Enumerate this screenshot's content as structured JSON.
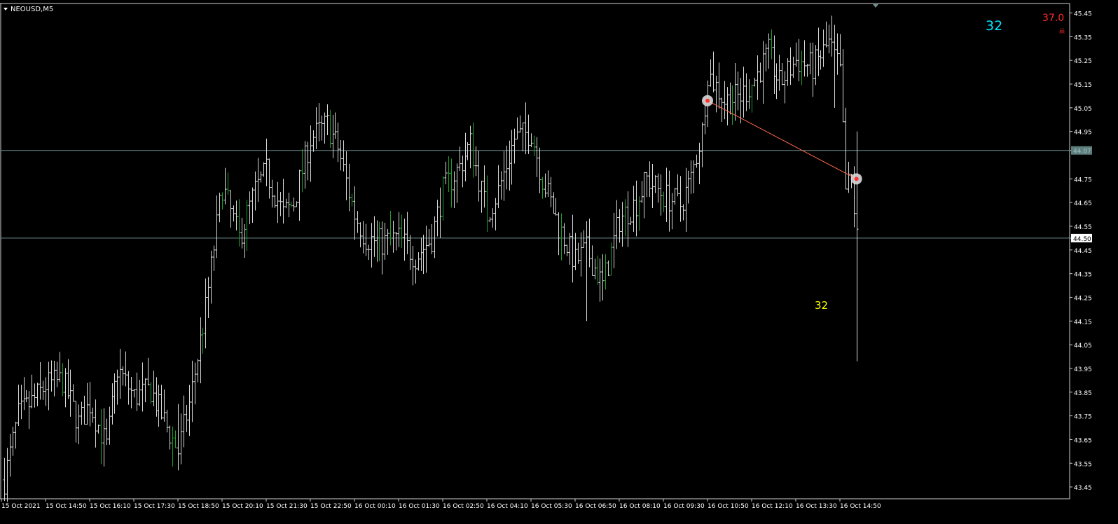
{
  "window": {
    "symbol_title": "NEOUSD,M5"
  },
  "indicators": {
    "counter_cyan": "32",
    "counter_red": "37.0",
    "counter_yellow": "32"
  },
  "colors": {
    "background": "#000000",
    "bar": "#d9d9d9",
    "bar_up": "#1f9e2a",
    "grid_line": "#6f8f8f",
    "trend_line": "#ff6a4a",
    "axis_text": "#ffffff",
    "cyan_text": "#00e5ff",
    "red_text": "#ff2a2a",
    "yellow_text": "#ffff00"
  },
  "chart_data": {
    "type": "ohlc",
    "symbol": "NEOUSD",
    "timeframe": "M5",
    "ylim": [
      43.4,
      45.49
    ],
    "y_ticks": [
      "45.45",
      "45.35",
      "45.25",
      "45.15",
      "45.05",
      "44.95",
      "44.87",
      "44.75",
      "44.65",
      "44.55",
      "44.50",
      "44.45",
      "44.35",
      "44.25",
      "44.15",
      "44.05",
      "43.95",
      "43.85",
      "43.75",
      "43.65",
      "43.55",
      "43.45"
    ],
    "x_ticks": [
      "15 Oct 2021",
      "15 Oct 14:50",
      "15 Oct 16:10",
      "15 Oct 17:30",
      "15 Oct 18:50",
      "15 Oct 20:10",
      "15 Oct 21:30",
      "15 Oct 22:50",
      "16 Oct 00:10",
      "16 Oct 01:30",
      "16 Oct 02:50",
      "16 Oct 04:10",
      "16 Oct 05:30",
      "16 Oct 06:50",
      "16 Oct 08:10",
      "16 Oct 09:30",
      "16 Oct 10:50",
      "16 Oct 12:10",
      "16 Oct 13:30",
      "16 Oct 14:50"
    ],
    "horizontal_lines": [
      {
        "price": 44.87,
        "label": "44.87"
      },
      {
        "price": 44.5,
        "label": "44.50"
      }
    ],
    "trend_line": {
      "from": {
        "time": "16 Oct 10:50",
        "price": 45.08
      },
      "to": {
        "time": "16 Oct 15:20",
        "price": 44.75
      }
    },
    "series_path": [
      {
        "t": "15 Oct 13:35",
        "p": 43.48
      },
      {
        "t": "15 Oct 14:00",
        "p": 43.75
      },
      {
        "t": "15 Oct 14:30",
        "p": 43.82
      },
      {
        "t": "15 Oct 14:50",
        "p": 43.88
      },
      {
        "t": "15 Oct 15:20",
        "p": 43.9
      },
      {
        "t": "15 Oct 15:50",
        "p": 43.72
      },
      {
        "t": "15 Oct 16:10",
        "p": 43.8
      },
      {
        "t": "15 Oct 16:40",
        "p": 43.62
      },
      {
        "t": "15 Oct 17:00",
        "p": 43.95
      },
      {
        "t": "15 Oct 17:30",
        "p": 43.83
      },
      {
        "t": "15 Oct 18:00",
        "p": 43.86
      },
      {
        "t": "15 Oct 18:30",
        "p": 43.7
      },
      {
        "t": "15 Oct 18:50",
        "p": 43.6
      },
      {
        "t": "15 Oct 19:10",
        "p": 43.8
      },
      {
        "t": "15 Oct 19:40",
        "p": 44.2
      },
      {
        "t": "15 Oct 20:00",
        "p": 44.55
      },
      {
        "t": "15 Oct 20:10",
        "p": 44.72
      },
      {
        "t": "15 Oct 20:40",
        "p": 44.5
      },
      {
        "t": "15 Oct 21:10",
        "p": 44.7
      },
      {
        "t": "15 Oct 21:30",
        "p": 44.78
      },
      {
        "t": "15 Oct 22:00",
        "p": 44.6
      },
      {
        "t": "15 Oct 22:20",
        "p": 44.65
      },
      {
        "t": "15 Oct 22:50",
        "p": 44.92
      },
      {
        "t": "15 Oct 23:20",
        "p": 44.98
      },
      {
        "t": "15 Oct 23:40",
        "p": 44.88
      },
      {
        "t": "16 Oct 00:10",
        "p": 44.6
      },
      {
        "t": "16 Oct 00:30",
        "p": 44.5
      },
      {
        "t": "16 Oct 01:00",
        "p": 44.48
      },
      {
        "t": "16 Oct 01:30",
        "p": 44.5
      },
      {
        "t": "16 Oct 02:00",
        "p": 44.42
      },
      {
        "t": "16 Oct 02:30",
        "p": 44.5
      },
      {
        "t": "16 Oct 02:50",
        "p": 44.7
      },
      {
        "t": "16 Oct 03:20",
        "p": 44.8
      },
      {
        "t": "16 Oct 03:40",
        "p": 44.9
      },
      {
        "t": "16 Oct 04:10",
        "p": 44.6
      },
      {
        "t": "16 Oct 04:30",
        "p": 44.7
      },
      {
        "t": "16 Oct 05:00",
        "p": 44.92
      },
      {
        "t": "16 Oct 05:30",
        "p": 44.95
      },
      {
        "t": "16 Oct 05:50",
        "p": 44.75
      },
      {
        "t": "16 Oct 06:20",
        "p": 44.55
      },
      {
        "t": "16 Oct 06:50",
        "p": 44.4
      },
      {
        "t": "16 Oct 07:10",
        "p": 44.45
      },
      {
        "t": "16 Oct 07:40",
        "p": 44.3
      },
      {
        "t": "16 Oct 08:10",
        "p": 44.58
      },
      {
        "t": "16 Oct 08:40",
        "p": 44.65
      },
      {
        "t": "16 Oct 09:00",
        "p": 44.75
      },
      {
        "t": "16 Oct 09:30",
        "p": 44.68
      },
      {
        "t": "16 Oct 10:00",
        "p": 44.64
      },
      {
        "t": "16 Oct 10:20",
        "p": 44.75
      },
      {
        "t": "16 Oct 10:40",
        "p": 44.95
      },
      {
        "t": "16 Oct 10:50",
        "p": 45.2
      },
      {
        "t": "16 Oct 11:20",
        "p": 45.08
      },
      {
        "t": "16 Oct 11:50",
        "p": 45.1
      },
      {
        "t": "16 Oct 12:10",
        "p": 45.15
      },
      {
        "t": "16 Oct 12:40",
        "p": 45.28
      },
      {
        "t": "16 Oct 13:00",
        "p": 45.15
      },
      {
        "t": "16 Oct 13:30",
        "p": 45.25
      },
      {
        "t": "16 Oct 14:00",
        "p": 45.22
      },
      {
        "t": "16 Oct 14:30",
        "p": 45.32
      },
      {
        "t": "16 Oct 14:50",
        "p": 45.2
      },
      {
        "t": "16 Oct 15:00",
        "p": 44.7
      },
      {
        "t": "16 Oct 15:10",
        "p": 44.75
      },
      {
        "t": "16 Oct 15:20",
        "p": 44.5
      }
    ],
    "extremes": [
      {
        "t": "16 Oct 15:20",
        "low": 43.98,
        "high": 44.95
      },
      {
        "t": "16 Oct 07:10",
        "low": 44.15,
        "high": 44.5
      },
      {
        "t": "15 Oct 18:50",
        "low": 43.52,
        "high": 43.8
      },
      {
        "t": "16 Oct 14:40",
        "low": 45.05,
        "high": 45.4
      }
    ]
  }
}
